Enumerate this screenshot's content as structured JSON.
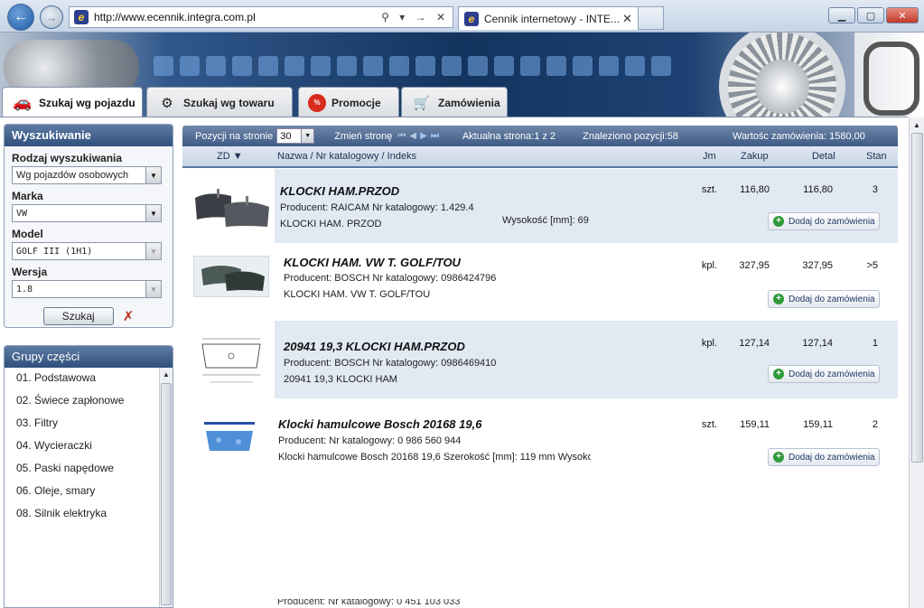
{
  "browser": {
    "url": "http://www.ecennik.integra.com.pl",
    "tab_title": "Cennik internetowy - INTE...",
    "addr_tools": "⚲ ▾ → ✕"
  },
  "site_tabs": [
    {
      "label": "Szukaj wg pojazdu",
      "icon": "car-icon"
    },
    {
      "label": "Szukaj wg towaru",
      "icon": "parts-icon"
    },
    {
      "label": "Promocje",
      "icon": "promo-badge-icon"
    },
    {
      "label": "Zamówienia",
      "icon": "cart-icon"
    }
  ],
  "search": {
    "title": "Wyszukiwanie",
    "type_label": "Rodzaj wyszukiwania",
    "type_value": "Wg pojazdów osobowych",
    "make_label": "Marka",
    "make_value": "VW",
    "model_label": "Model",
    "model_value": "GOLF III (1H1)",
    "version_label": "Wersja",
    "version_value": "1.8",
    "search_button": "Szukaj"
  },
  "groups": {
    "title": "Grupy części",
    "items": [
      "01. Podstawowa",
      "02. Świece zapłonowe",
      "03. Filtry",
      "04. Wycieraczki",
      "05. Paski napędowe",
      "06. Oleje, smary",
      "08. Silnik elektryka"
    ]
  },
  "toolbar": {
    "per_page_label": "Pozycji na stronie",
    "per_page_value": "30",
    "change_page_label": "Zmień stronę",
    "current_page": "Aktualna strona:1 z 2",
    "found": "Znaleziono pozycji:58",
    "order_value": "Wartośc zamówienia: 1580,00"
  },
  "columns": {
    "zd": "ZD ▼",
    "name": "Nazwa  /  Nr katalogowy  /  Indeks",
    "jm": "Jm",
    "zakup": "Zakup",
    "detal": "Detal",
    "stan": "Stan"
  },
  "add_button_label": "Dodaj do zamówienia",
  "products": [
    {
      "name": "KLOCKI HAM.PRZOD",
      "producer": "Producent: RAICAM  Nr katalogowy: 1.429.4",
      "desc": "KLOCKI HAM. PRZOD",
      "extra": "Wysokość [mm]: 69",
      "jm": "szt.",
      "zakup": "116,80",
      "detal": "116,80",
      "stan": "3"
    },
    {
      "name": "KLOCKI HAM. VW T. GOLF/TOU",
      "producer": "Producent: BOSCH   Nr katalogowy: 0986424796",
      "desc": "KLOCKI HAM. VW T. GOLF/TOU",
      "extra": "",
      "jm": "kpl.",
      "zakup": "327,95",
      "detal": "327,95",
      "stan": ">5"
    },
    {
      "name": "20941 19,3 KLOCKI HAM.PRZOD",
      "producer": "Producent: BOSCH  Nr katalogowy: 0986469410",
      "desc": "20941  19,3 KLOCKI HAM",
      "extra": "",
      "jm": "kpl.",
      "zakup": "127,14",
      "detal": "127,14",
      "stan": "1"
    },
    {
      "name": "Klocki hamulcowe Bosch 20168 19,6",
      "producer": "Producent:     Nr katalogowy: 0 986 560 944",
      "desc": "Klocki hamulcowe Bosch 20168 19,6 Szerokość [mm]: 119 mm Wysoko",
      "extra": "",
      "jm": "szt.",
      "zakup": "159,11",
      "detal": "159,11",
      "stan": "2"
    }
  ],
  "cut_row_text": "Producent:     Nr katalogowy: 0 451 103 033",
  "colors": {
    "panel_header": "#2f4f7d",
    "row_alt": "#e1e9f3",
    "add_icon": "#2e9a3a"
  }
}
